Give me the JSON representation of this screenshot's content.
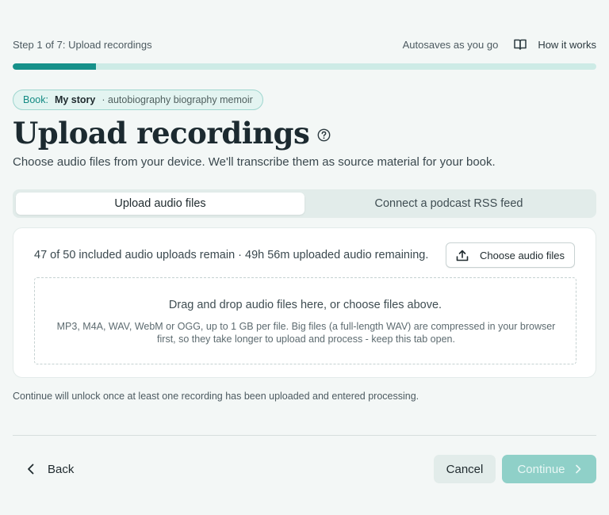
{
  "header": {
    "step_label": "Step 1 of 7: Upload recordings",
    "autosave_text": "Autosaves as you go",
    "how_it_works_label": "How it works"
  },
  "progress": {
    "current_step": 1,
    "total_steps": 7
  },
  "book": {
    "label": "Book:",
    "title": "My story",
    "tags": "· autobiography biography memoir"
  },
  "page": {
    "title": "Upload recordings",
    "subtitle": "Choose audio files from your device. We'll transcribe them as source material for your book."
  },
  "tabs": [
    {
      "label": "Upload audio files",
      "active": true
    },
    {
      "label": "Connect a podcast RSS feed",
      "active": false
    }
  ],
  "upload": {
    "quota_text": "47 of 50 included audio uploads remain · 49h 56m uploaded audio remaining.",
    "choose_button_label": "Choose audio files",
    "dropzone_main": "Drag and drop audio files here, or choose files above.",
    "dropzone_sub": "MP3, M4A, WAV, WebM or OGG, up to 1 GB per file. Big files (a full-length WAV) are compressed in your browser first, so they take longer to upload and process - keep this tab open."
  },
  "hint": "Continue will unlock once at least one recording has been uploaded and entered processing.",
  "footer": {
    "back_label": "Back",
    "cancel_label": "Cancel",
    "continue_label": "Continue"
  },
  "colors": {
    "accent": "#16918a",
    "progress_track": "#cdebe6",
    "continue_disabled": "#8fd0c8",
    "background": "#f3f7f6"
  },
  "icons": {
    "how_it_works": "book-open-icon",
    "help": "question-circle-icon",
    "choose": "upload-icon",
    "back": "chevron-left-icon",
    "continue": "chevron-right-icon"
  }
}
